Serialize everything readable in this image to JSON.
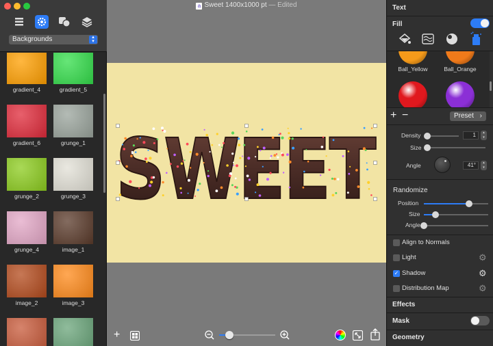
{
  "window": {
    "title": "Sweet 1400x1000 pt",
    "status": "— Edited",
    "doc_icon_letter": "a"
  },
  "sidebar": {
    "dropdown_value": "Backgrounds",
    "tools": [
      "list-icon",
      "gear-icon",
      "shapes-icon",
      "layers-icon"
    ],
    "tiles": [
      {
        "label": "gradient_4",
        "color": "#ff9f00"
      },
      {
        "label": "gradient_5",
        "color": "#33dd4a"
      },
      {
        "label": "gradient_6",
        "color": "#e02a3a"
      },
      {
        "label": "grunge_1",
        "color": "#9aa49c"
      },
      {
        "label": "grunge_2",
        "color": "#8ccc1e"
      },
      {
        "label": "grunge_3",
        "color": "#e2e0d6"
      },
      {
        "label": "grunge_4",
        "color": "#e3a7c6"
      },
      {
        "label": "image_1",
        "color": "#5a3a2a"
      },
      {
        "label": "image_2",
        "color": "#b34a1c"
      },
      {
        "label": "image_3",
        "color": "#ff8a1a"
      },
      {
        "label": "",
        "color": "#c85a3a"
      },
      {
        "label": "",
        "color": "#6aa57a"
      }
    ]
  },
  "canvas": {
    "text": "SWEET",
    "artboard_color": "#f2e4a4",
    "zoom_level": 0.18
  },
  "right_panel": {
    "text_header": "Text",
    "fill_label": "Fill",
    "fill_toggle_on": true,
    "fill_icons": [
      "fill-bucket-icon",
      "texture-icon",
      "ball-icon",
      "spray-icon"
    ],
    "presets": [
      {
        "label": "Ball_Yellow",
        "color": "#f59a1a"
      },
      {
        "label": "Ball_Orange",
        "color": "#f07a1a"
      },
      {
        "label": "",
        "color": "#e0181e"
      },
      {
        "label": "",
        "color": "#8b2fd6"
      }
    ],
    "preset_button": "Preset",
    "density_label": "Density",
    "density_value": "1",
    "density_fraction": 0.0,
    "size_label": "Size",
    "size_fraction": 0.0,
    "angle_label": "Angle",
    "angle_value": "41°",
    "randomize_header": "Randomize",
    "position_label": "Position",
    "position_fraction": 0.7,
    "rand_size_label": "Size",
    "rand_size_fraction": 0.18,
    "rand_angle_label": "Angle",
    "rand_angle_fraction": 0.0,
    "options": [
      {
        "label": "Align to Normals",
        "checked": false,
        "gear": false
      },
      {
        "label": "Light",
        "checked": false,
        "gear": true
      },
      {
        "label": "Shadow",
        "checked": true,
        "gear": true
      },
      {
        "label": "Distribution Map",
        "checked": false,
        "gear": true
      }
    ],
    "effects_header": "Effects",
    "mask_header": "Mask",
    "mask_toggle_on": false,
    "geometry_header": "Geometry"
  },
  "colors": {
    "accent": "#2d7cf6",
    "chocolate": "#4a2c26"
  }
}
